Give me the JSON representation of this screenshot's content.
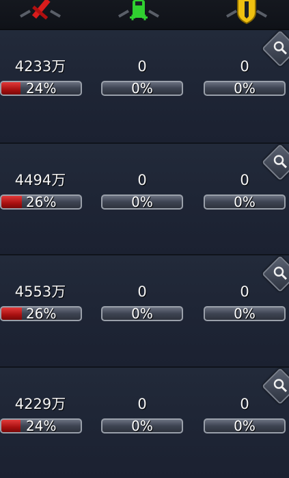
{
  "header": {
    "icons": [
      "sword-icon",
      "heal-cross-icon",
      "shield-icon"
    ]
  },
  "rows": [
    {
      "damage": "4233万",
      "damage_pct": "24%",
      "damage_fraction": 0.24,
      "heal": "0",
      "heal_pct": "0%",
      "tank": "0",
      "tank_pct": "0%"
    },
    {
      "damage": "4494万",
      "damage_pct": "26%",
      "damage_fraction": 0.26,
      "heal": "0",
      "heal_pct": "0%",
      "tank": "0",
      "tank_pct": "0%"
    },
    {
      "damage": "4553万",
      "damage_pct": "26%",
      "damage_fraction": 0.26,
      "heal": "0",
      "heal_pct": "0%",
      "tank": "0",
      "tank_pct": "0%"
    },
    {
      "damage": "4229万",
      "damage_pct": "24%",
      "damage_fraction": 0.24,
      "heal": "0",
      "heal_pct": "0%",
      "tank": "0",
      "tank_pct": "0%"
    }
  ],
  "colors": {
    "damage": "#c01818",
    "heal": "#2fd12f",
    "tank": "#f2c40c"
  }
}
